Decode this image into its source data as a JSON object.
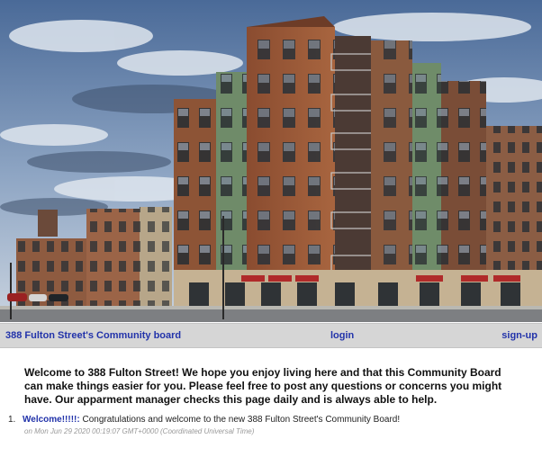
{
  "nav": {
    "home_label": "388 Fulton Street's Community board",
    "login_label": "login",
    "signup_label": "sign-up"
  },
  "welcome_text": "Welcome to 388 Fulton Street! We hope you enjoy living here and that this Community Board can make things easier for you. Please feel free to post any questions or concerns you might have. Our apparment manager checks this page daily and is always able to help.",
  "posts": [
    {
      "number": "1.",
      "title": "Welcome!!!!!:",
      "body": " Congratulations and welcome to the new 388 Fulton Street's Community Board!",
      "meta": "on Mon Jun 29 2020 00:19:07 GMT+0000 (Coordinated Universal Time)"
    }
  ],
  "colors": {
    "link": "#2233aa",
    "navbar": "#d6d6d6",
    "sky_top": "#4f6f9c",
    "brick": "#9a5a3a",
    "green_panel": "#6e8c6a",
    "awning": "#b02a2a"
  },
  "hero_image": {
    "icon": "apartment-building-photo"
  }
}
